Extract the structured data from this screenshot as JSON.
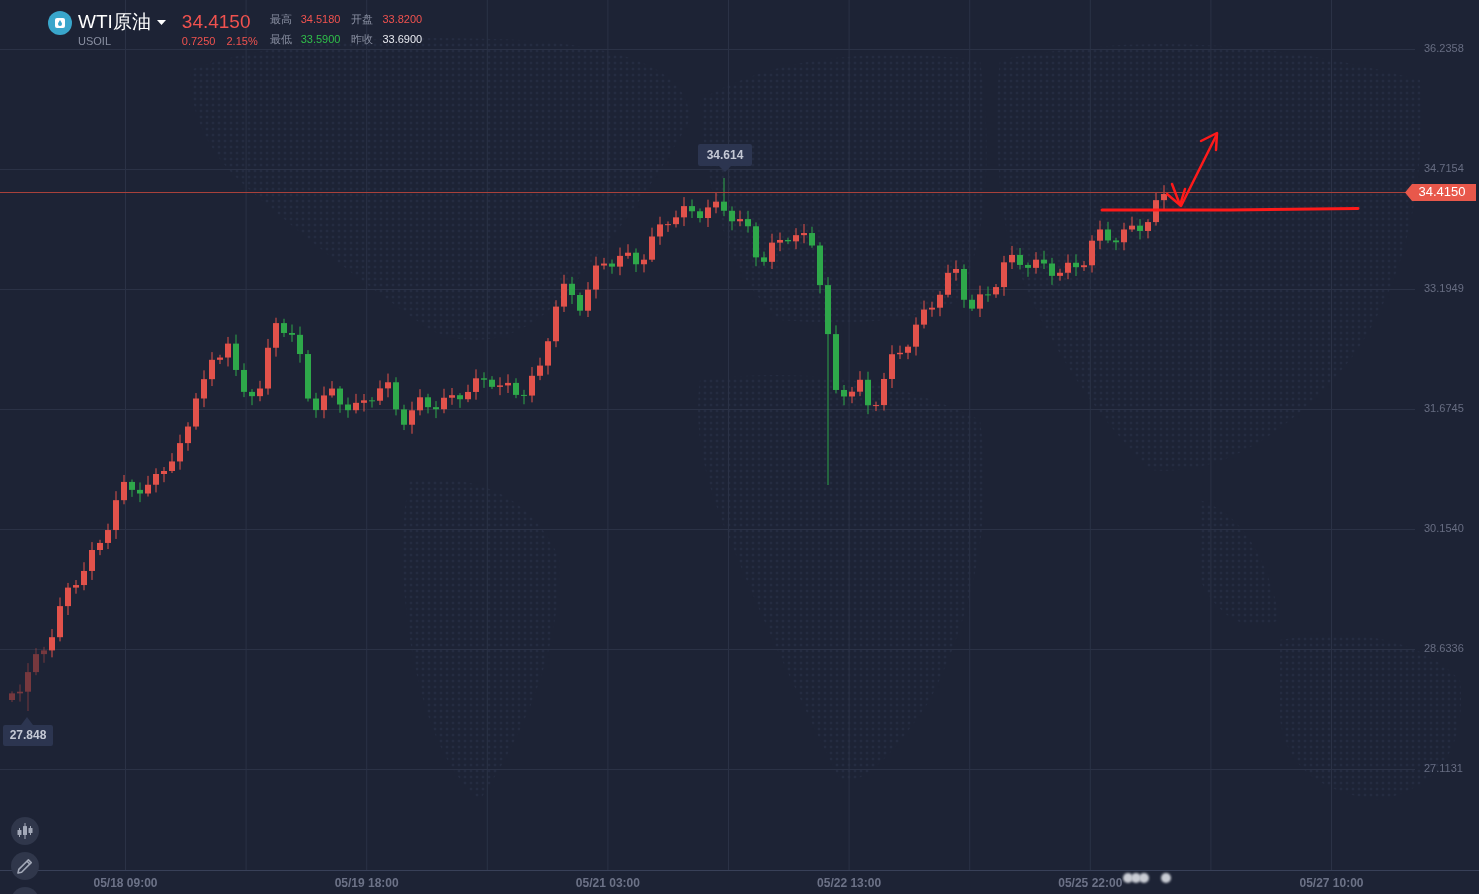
{
  "instrument": {
    "name": "WTI原油",
    "symbol": "USOIL",
    "price": "34.4150",
    "change": "0.7250",
    "change_percent": "2.15%",
    "color": "#f0524f"
  },
  "stats": [
    {
      "label": "最高",
      "value": "34.5180",
      "color": "#f0524f"
    },
    {
      "label": "开盘",
      "value": "33.8200",
      "color": "#f0524f"
    },
    {
      "label": "最低",
      "value": "33.5900",
      "color": "#2fbf4a"
    },
    {
      "label": "昨收",
      "value": "33.6900"
    }
  ],
  "chart": {
    "y_axis_labels": [
      "36.2358",
      "34.7154",
      "33.1949",
      "31.6745",
      "30.1540",
      "28.6336",
      "27.1131"
    ],
    "x_axis_labels": [
      "05/18 09:00",
      "05/19 18:00",
      "05/21 03:00",
      "05/22 13:00",
      "05/25 22:00",
      "05/27 10:00"
    ],
    "last_price": "34.4150",
    "high_marker": "34.614",
    "low_marker": "27.848"
  },
  "toolbar": [
    {
      "kind": "candles"
    },
    {
      "kind": "pencil"
    },
    {
      "kind": "blank"
    }
  ]
}
